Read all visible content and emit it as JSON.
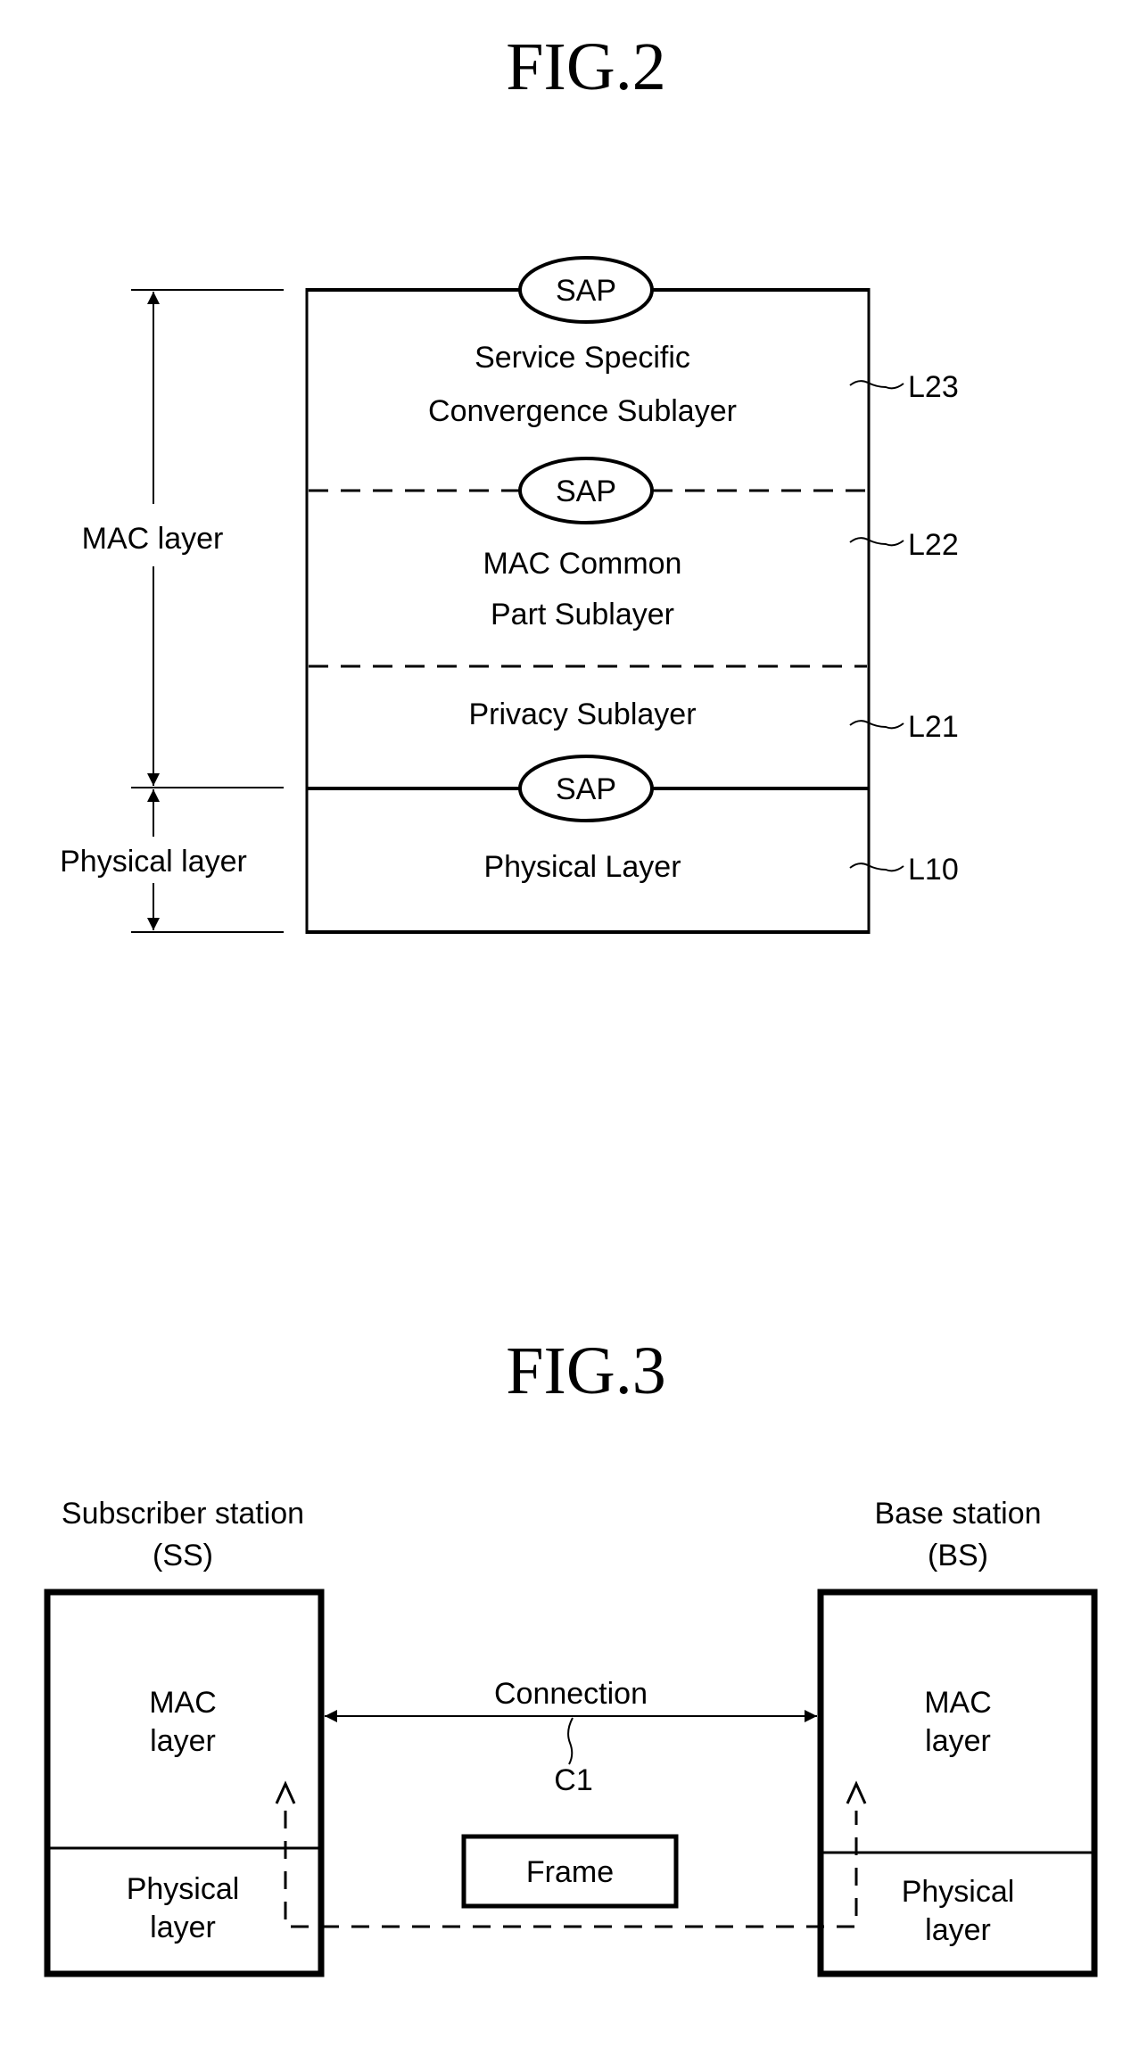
{
  "fig2": {
    "title": "FIG.2",
    "left_labels": {
      "mac_layer": "MAC layer",
      "physical_layer": "Physical layer"
    },
    "sap_label": "SAP",
    "layers": [
      {
        "id": "L23",
        "ref": "L23",
        "lines": [
          "Service Specific",
          "Convergence Sublayer"
        ]
      },
      {
        "id": "L22",
        "ref": "L22",
        "lines": [
          "MAC Common",
          "Part Sublayer"
        ]
      },
      {
        "id": "L21",
        "ref": "L21",
        "lines": [
          "Privacy Sublayer"
        ]
      },
      {
        "id": "L10",
        "ref": "L10",
        "lines": [
          "Physical Layer"
        ]
      }
    ]
  },
  "fig3": {
    "title": "FIG.3",
    "subscriber_station": {
      "name_line1": "Subscriber station",
      "name_line2": "(SS)",
      "mac_line1": "MAC",
      "mac_line2": "layer",
      "phy_line1": "Physical",
      "phy_line2": "layer"
    },
    "base_station": {
      "name_line1": "Base station",
      "name_line2": "(BS)",
      "mac_line1": "MAC",
      "mac_line2": "layer",
      "phy_line1": "Physical",
      "phy_line2": "layer"
    },
    "connection_label": "Connection",
    "connection_ref": "C1",
    "frame_label": "Frame"
  }
}
